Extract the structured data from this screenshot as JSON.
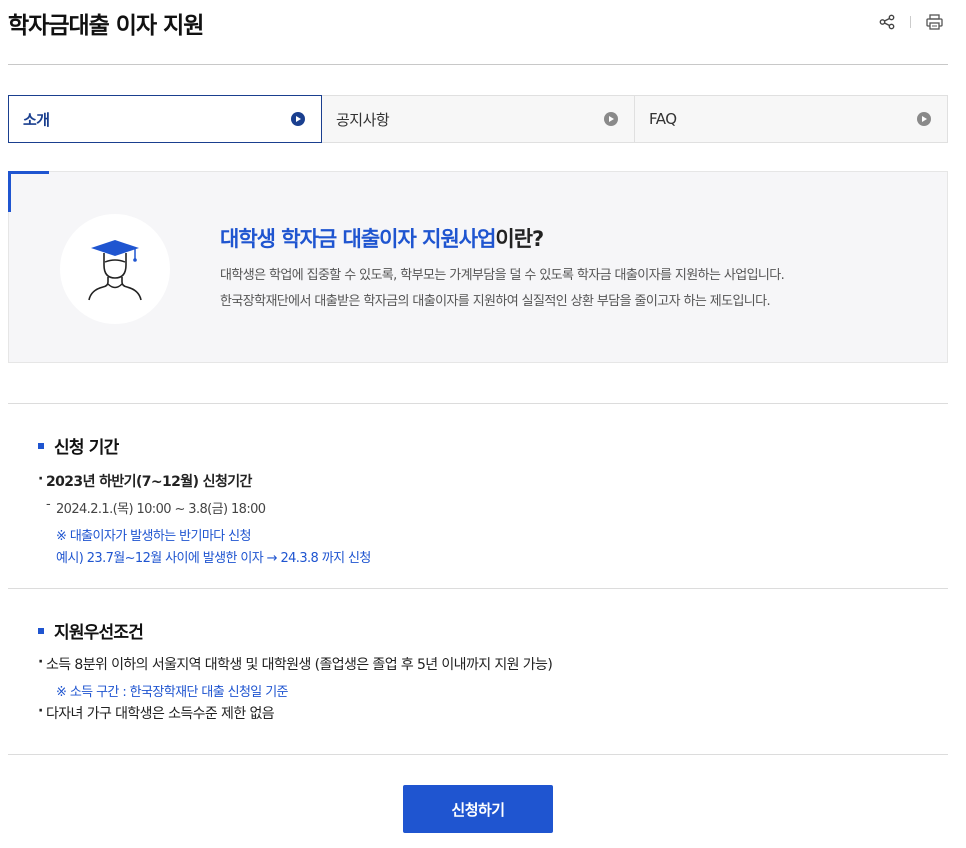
{
  "page": {
    "title": "학자금대출 이자 지원"
  },
  "header_tools": {
    "share_icon": "share-icon",
    "print_icon": "print-icon"
  },
  "tabs": [
    {
      "label": "소개",
      "active": true
    },
    {
      "label": "공지사항",
      "active": false
    },
    {
      "label": "FAQ",
      "active": false
    }
  ],
  "intro": {
    "icon": "graduate-icon",
    "heading_highlight": "대학생 학자금 대출이자 지원사업",
    "heading_rest": "이란?",
    "desc_lines": [
      "대학생은 학업에 집중할 수 있도록, 학부모는 가계부담을 덜 수 있도록 학자금 대출이자를 지원하는 사업입니다.",
      "한국장학재단에서 대출받은 학자금의 대출이자를 지원하여 실질적인 상환 부담을 줄이고자 하는 제도입니다."
    ]
  },
  "period": {
    "title": "신청 기간",
    "item": "2023년 하반기(7~12월) 신청기간",
    "date": "2024.2.1.(목) 10:00 ~ 3.8(금) 18:00",
    "note1": "※ 대출이자가 발생하는 반기마다 신청",
    "note2": "예시) 23.7월~12월 사이에 발생한 이자 → 24.3.8 까지 신청"
  },
  "priority": {
    "title": "지원우선조건",
    "item1": "소득 8분위 이하의 서울지역 대학생 및 대학원생 (졸업생은 졸업 후 5년 이내까지 지원 가능)",
    "note": "※ 소득 구간 : 한국장학재단 대출 신청일 기준",
    "item2": "다자녀 가구 대학생은 소득수준 제한 없음"
  },
  "apply_button": {
    "label": "신청하기"
  },
  "colors": {
    "accent": "#1f55d0",
    "tab_active_border": "#1a3f8f",
    "intro_bg": "#f6f6f8"
  }
}
